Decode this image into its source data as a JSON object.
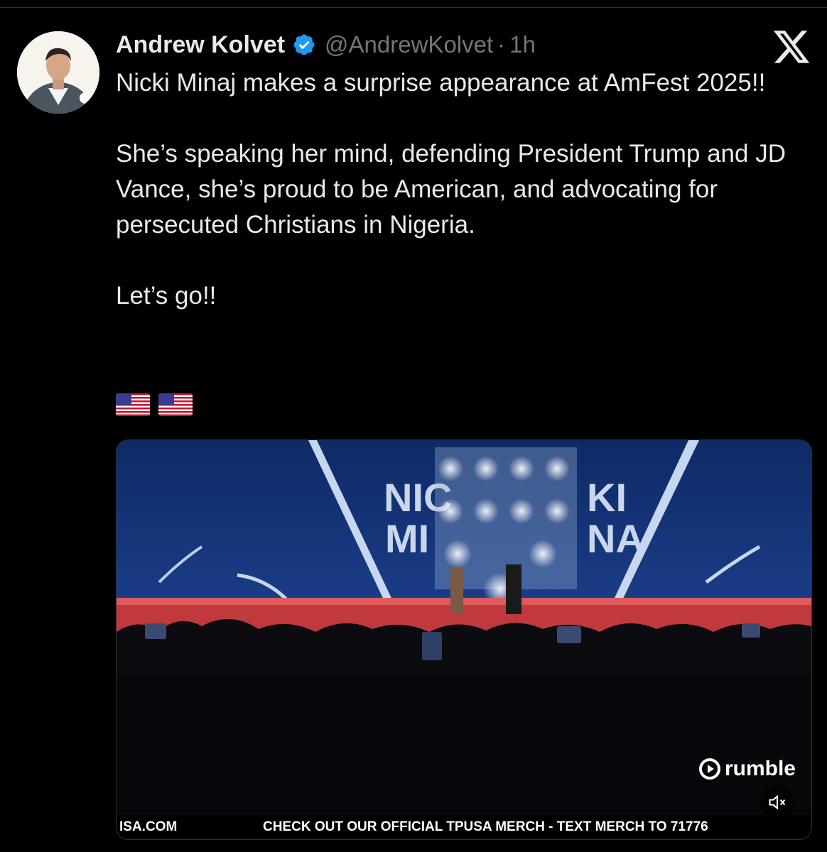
{
  "author": {
    "name": "Andrew Kolvet",
    "handle": "@AndrewKolvet",
    "separator": "·",
    "time": "1h",
    "verified_color": "#1d9bf0"
  },
  "tweet": {
    "paragraph1": "Nicki Minaj makes a surprise appearance at AmFest 2025!!",
    "paragraph2": "She’s speaking her mind, defending President Trump and JD Vance, she’s proud to be American, and advocating for persecuted Christians in Nigeria.",
    "paragraph3": "Let’s go!!",
    "flags": [
      "us-flag",
      "us-flag"
    ]
  },
  "media": {
    "stage_text_left_1": "NIC",
    "stage_text_left_2": "MI",
    "stage_text_right_1": "KI",
    "stage_text_right_2": "NA",
    "watermark": "rumble",
    "ticker_left": "ISA.COM",
    "ticker_main": "CHECK OUT OUR OFFICIAL TPUSA MERCH - TEXT MERCH TO 71776",
    "sound_state": "muted"
  },
  "icons": {
    "platform": "x-logo-icon",
    "verified": "verified-badge-icon",
    "mute": "speaker-muted-icon",
    "play": "rumble-play-icon"
  }
}
